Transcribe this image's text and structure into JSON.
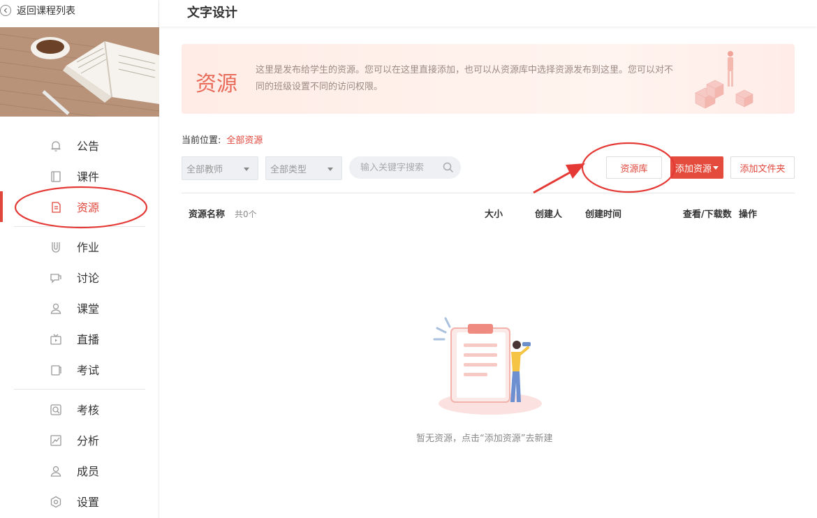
{
  "sidebar": {
    "back_label": "返回课程列表",
    "items": [
      {
        "label": "公告",
        "icon": "bell-icon"
      },
      {
        "label": "课件",
        "icon": "book-icon"
      },
      {
        "label": "资源",
        "icon": "resource-icon",
        "active": true
      },
      {
        "label": "作业",
        "icon": "homework-icon"
      },
      {
        "label": "讨论",
        "icon": "discussion-icon"
      },
      {
        "label": "课堂",
        "icon": "classroom-icon"
      },
      {
        "label": "直播",
        "icon": "live-icon"
      },
      {
        "label": "考试",
        "icon": "exam-icon"
      },
      {
        "label": "考核",
        "icon": "assessment-icon"
      },
      {
        "label": "分析",
        "icon": "analysis-icon"
      },
      {
        "label": "成员",
        "icon": "member-icon"
      },
      {
        "label": "设置",
        "icon": "settings-icon"
      }
    ]
  },
  "header": {
    "title": "文字设计"
  },
  "banner": {
    "title": "资源",
    "description": "这里是发布给学生的资源。您可以在这里直接添加，也可以从资源库中选择资源发布到这里。您可以对不同的班级设置不同的访问权限。"
  },
  "breadcrumb": {
    "label": "当前位置:",
    "current": "全部资源"
  },
  "filters": {
    "teacher": "全部教师",
    "type": "全部类型",
    "search_placeholder": "输入关键字搜索"
  },
  "actions": {
    "library": "资源库",
    "add_resource": "添加资源",
    "add_folder": "添加文件夹"
  },
  "table": {
    "columns": {
      "name": "资源名称",
      "count": "共0个",
      "size": "大小",
      "creator": "创建人",
      "created_time": "创建时间",
      "views": "查看/下载数",
      "ops": "操作"
    }
  },
  "empty_state": {
    "text": "暂无资源，点击“添加资源”去新建"
  },
  "colors": {
    "accent": "#e0463b",
    "banner_title": "#e96b5a",
    "annotation": "#e53935"
  }
}
